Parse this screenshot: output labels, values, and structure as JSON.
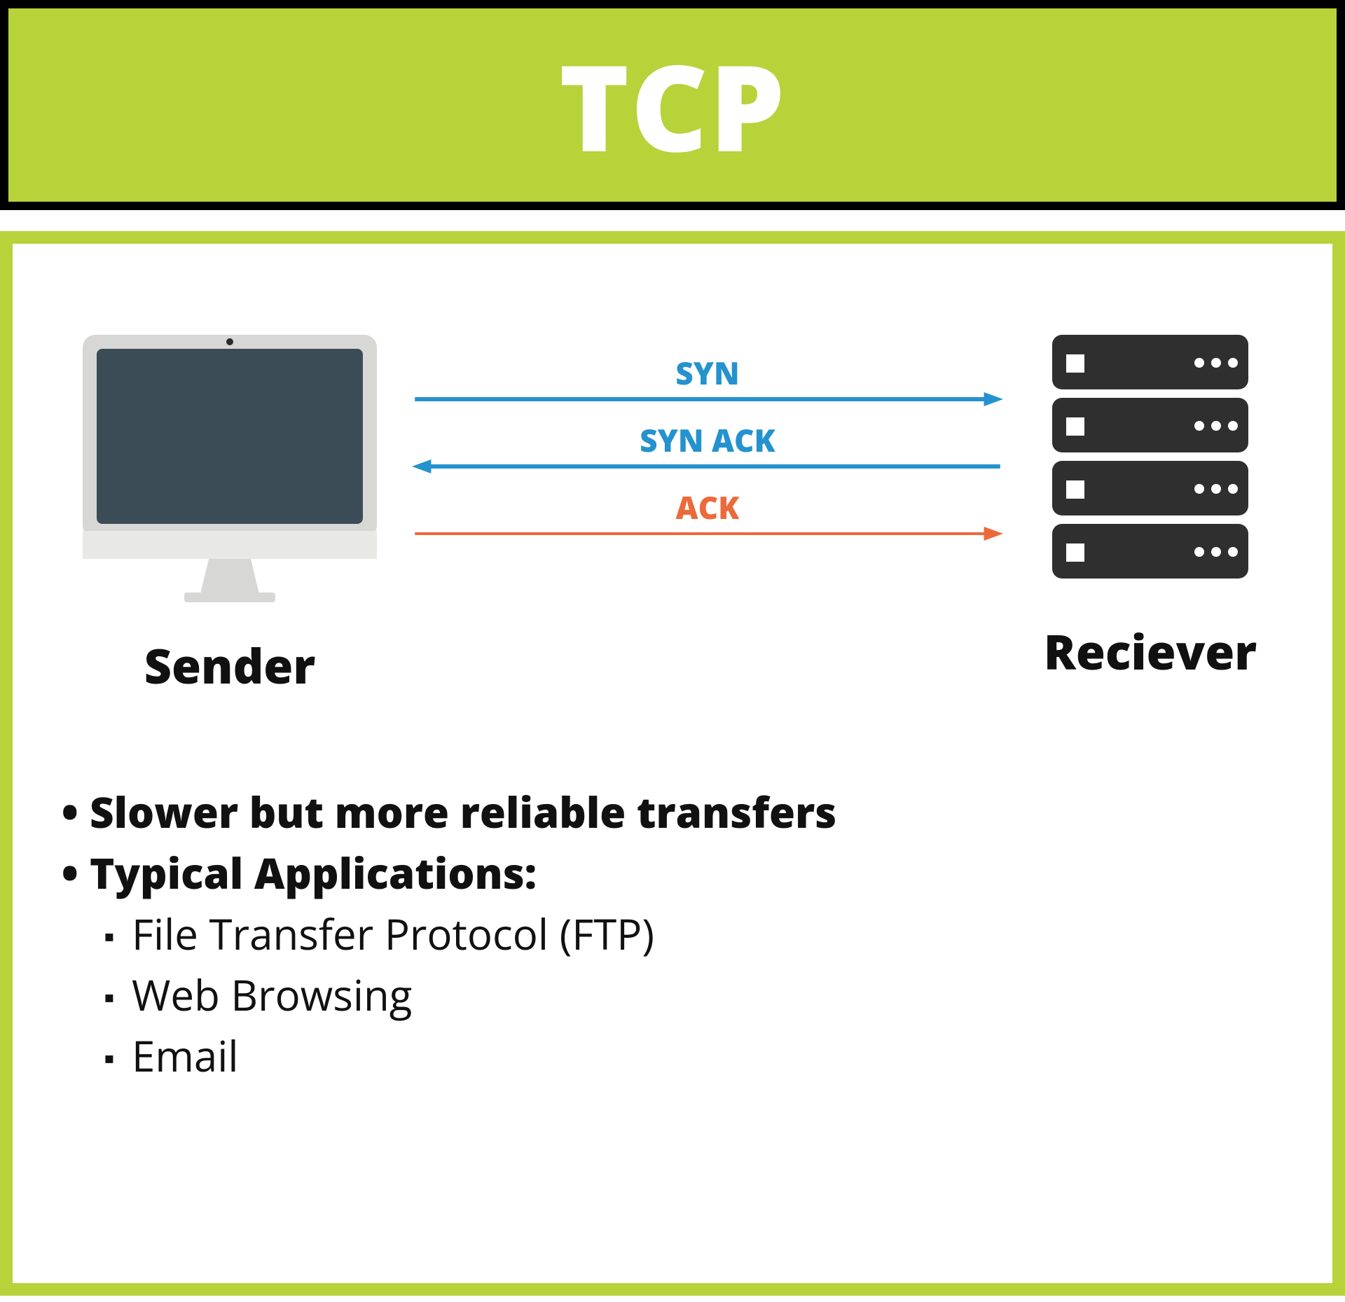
{
  "header": {
    "title": "TCP"
  },
  "diagram": {
    "sender_label": "Sender",
    "receiver_label": "Reciever",
    "arrows": [
      {
        "label": "SYN",
        "dir": "right",
        "color": "#2492cf"
      },
      {
        "label": "SYN ACK",
        "dir": "left",
        "color": "#2492cf"
      },
      {
        "label": "ACK",
        "dir": "right",
        "color": "#ec6a3a"
      }
    ]
  },
  "bullets": {
    "main": [
      "Slower but more reliable transfers",
      "Typical Applications:"
    ],
    "sub": [
      "File Transfer Protocol (FTP)",
      "Web Browsing",
      "Email"
    ]
  },
  "colors": {
    "accent": "#b8d23a",
    "blue": "#2492cf",
    "orange": "#ec6a3a",
    "monitor_body": "#d7d8d6",
    "monitor_screen": "#3b4c57",
    "server": "#2f2f2f"
  }
}
